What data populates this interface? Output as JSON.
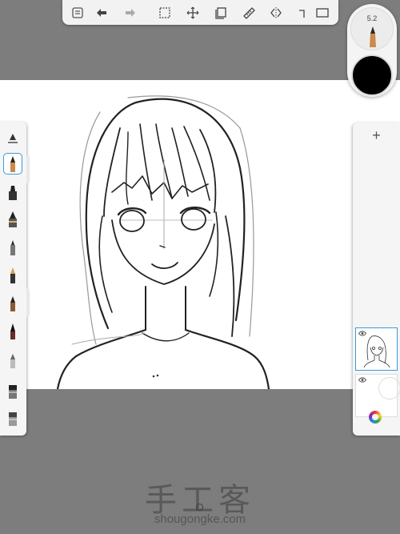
{
  "app": {
    "brush_size_value": "5.2",
    "active_color": "#000000",
    "accent_color": "#3a9ad9",
    "canvas_background": "#ffffff",
    "workspace_background": "#7d7d7d"
  },
  "toolbar": {
    "items": [
      {
        "name": "list-icon"
      },
      {
        "name": "undo-icon"
      },
      {
        "name": "redo-icon"
      },
      {
        "name": "select-icon"
      },
      {
        "name": "transform-icon"
      },
      {
        "name": "layers-stack-icon"
      },
      {
        "name": "ruler-icon"
      },
      {
        "name": "symmetry-icon"
      },
      {
        "name": "shape-icon"
      },
      {
        "name": "canvas-icon"
      }
    ]
  },
  "brushes": [
    {
      "name": "settings-brush-icon"
    },
    {
      "name": "pencil-brush-icon",
      "active": true
    },
    {
      "name": "marker-brush-icon"
    },
    {
      "name": "paint-brush-icon"
    },
    {
      "name": "ballpoint-brush-icon"
    },
    {
      "name": "fountain-pen-icon"
    },
    {
      "name": "ink-brush-icon"
    },
    {
      "name": "calligraphy-brush-icon"
    },
    {
      "name": "airbrush-icon"
    },
    {
      "name": "eraser-icon"
    },
    {
      "name": "smudge-icon"
    }
  ],
  "layers": {
    "add_label": "+",
    "items": [
      {
        "name": "layer-1",
        "visible": true,
        "active": true
      },
      {
        "name": "layer-2",
        "visible": true,
        "active": false
      }
    ]
  },
  "watermark": {
    "chinese": "手工客",
    "url": "shougongke.com"
  }
}
